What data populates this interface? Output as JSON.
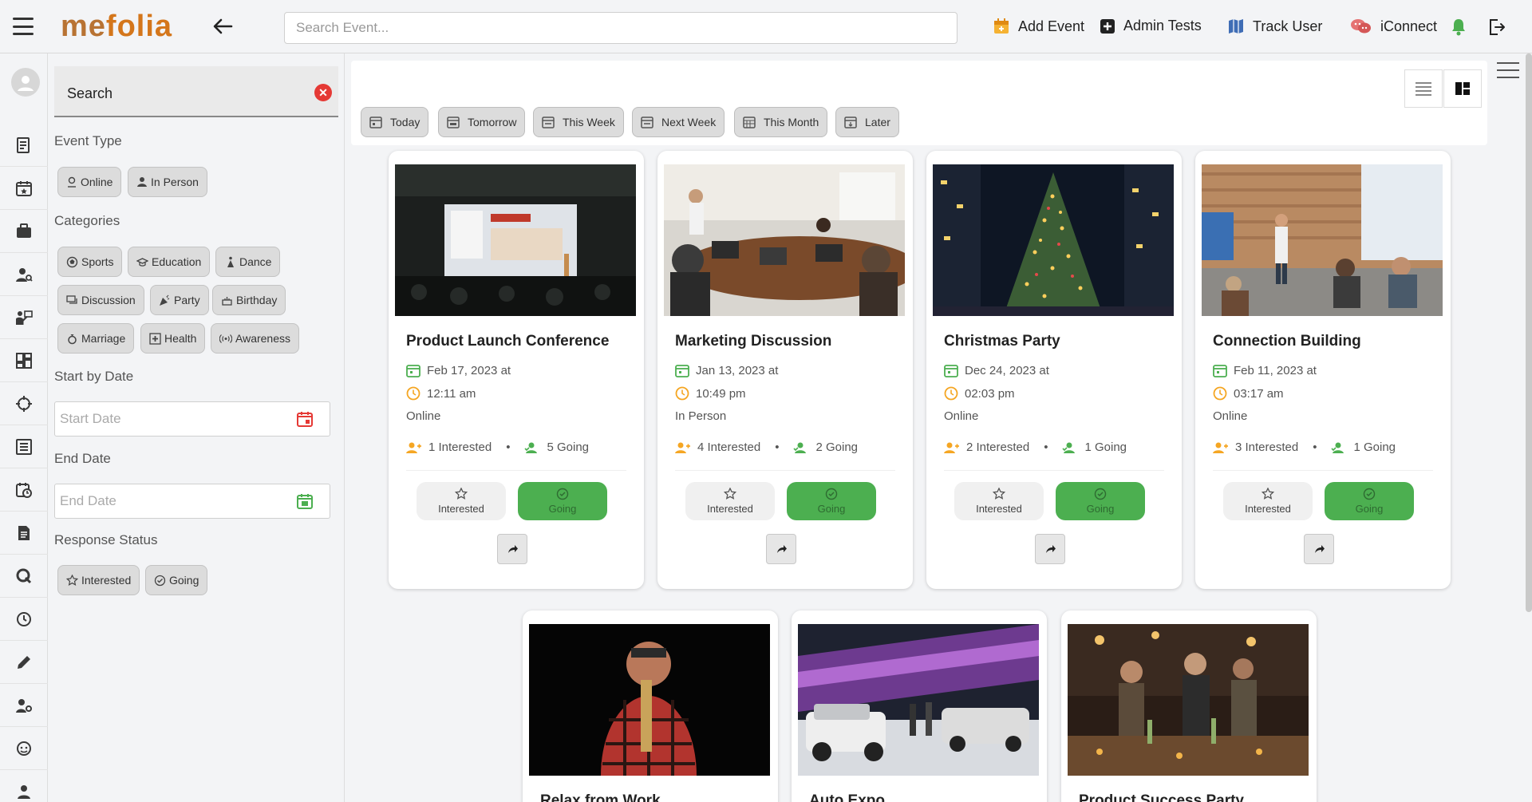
{
  "brand": {
    "logo_me": "me",
    "logo_folia": "folia"
  },
  "header": {
    "search_placeholder": "Search Event...",
    "actions": [
      {
        "label": "Add Event",
        "icon": "calendar-add-icon"
      },
      {
        "label": "Admin Tests",
        "icon": "plus-box-icon"
      },
      {
        "label": "Track User",
        "icon": "map-icon"
      },
      {
        "label": "iConnect",
        "icon": "chat-icon"
      }
    ]
  },
  "colors": {
    "accent": "#4caf50",
    "brand": "#d4761b",
    "danger": "#e53935",
    "interested": "#f5a623",
    "going": "#4caf50"
  },
  "sidebar_filters": {
    "search_label": "Search",
    "event_type": {
      "heading": "Event Type",
      "options": [
        "Online",
        "In Person"
      ]
    },
    "categories": {
      "heading": "Categories",
      "options": [
        "Sports",
        "Education",
        "Dance",
        "Discussion",
        "Party",
        "Birthday",
        "Marriage",
        "Health",
        "Awareness"
      ]
    },
    "start_date": {
      "heading": "Start by Date",
      "placeholder": "Start Date"
    },
    "end_date": {
      "heading": "End Date",
      "placeholder": "End Date"
    },
    "response_status": {
      "heading": "Response Status",
      "options": [
        "Interested",
        "Going"
      ]
    }
  },
  "date_filters": [
    "Today",
    "Tomorrow",
    "This Week",
    "Next Week",
    "This Month",
    "Later"
  ],
  "events": [
    {
      "title": "Product Launch Conference",
      "date": "Feb 17, 2023 at",
      "time": "12:11 am",
      "mode": "Online",
      "interested": "1 Interested",
      "going": "5 Going",
      "btn_interested": "Interested",
      "btn_going": "Going"
    },
    {
      "title": "Marketing Discussion",
      "date": "Jan 13, 2023 at",
      "time": "10:49 pm",
      "mode": "In Person",
      "interested": "4 Interested",
      "going": "2 Going",
      "btn_interested": "Interested",
      "btn_going": "Going"
    },
    {
      "title": "Christmas Party",
      "date": "Dec 24, 2023 at",
      "time": "02:03 pm",
      "mode": "Online",
      "interested": "2 Interested",
      "going": "1 Going",
      "btn_interested": "Interested",
      "btn_going": "Going"
    },
    {
      "title": "Connection Building",
      "date": "Feb 11, 2023 at",
      "time": "03:17 am",
      "mode": "Online",
      "interested": "3 Interested",
      "going": "1 Going",
      "btn_interested": "Interested",
      "btn_going": "Going"
    }
  ],
  "events_row2": [
    {
      "title": "Relax from Work"
    },
    {
      "title": "Auto Expo"
    },
    {
      "title": "Product Success Party"
    }
  ]
}
